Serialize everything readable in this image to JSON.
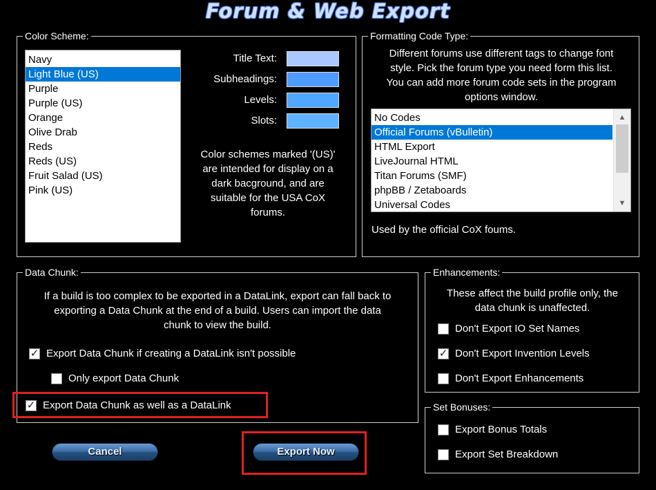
{
  "window": {
    "title": "Forum & Web Export"
  },
  "color_scheme": {
    "legend": "Color Scheme:",
    "items": [
      "Navy",
      "Light Blue (US)",
      "Purple",
      "Purple (US)",
      "Orange",
      "Olive Drab",
      "Reds",
      "Reds (US)",
      "Fruit Salad (US)",
      "Pink (US)"
    ],
    "selected": "Light Blue (US)",
    "swatches": [
      {
        "label": "Title Text:",
        "color": "#aac8ff"
      },
      {
        "label": "Subheadings:",
        "color": "#4f9cff"
      },
      {
        "label": "Levels:",
        "color": "#4fa8ff"
      },
      {
        "label": "Slots:",
        "color": "#5eb2ff"
      }
    ],
    "note_lines": [
      "Color schemes marked '(US)'",
      "are intended for display on a",
      "dark bacground, and are",
      "suitable for the USA CoX",
      "forums."
    ]
  },
  "formatting": {
    "legend": "Formatting Code Type:",
    "description_lines": [
      "Different forums use different tags to change font",
      "style. Pick the forum type you need form this list.",
      "You can add more forum code sets in the program",
      "options window."
    ],
    "items": [
      "No Codes",
      "Official Forums (vBulletin)",
      "HTML Export",
      "LiveJournal HTML",
      "Titan Forums (SMF)",
      "phpBB / Zetaboards",
      "Universal Codes"
    ],
    "selected": "Official Forums (vBulletin)",
    "footer": "Used by the official CoX foums."
  },
  "data_chunk": {
    "legend": "Data Chunk:",
    "description_lines": [
      "If a build is too complex to be exported in a DataLink, export can fall back to",
      "exporting a Data Chunk at the end of a build. Users can import the data",
      "chunk to view the build."
    ],
    "checkboxes": [
      {
        "label": "Export Data Chunk if creating a DataLink isn't possible",
        "checked": true
      },
      {
        "label": "Only export Data Chunk",
        "checked": false
      },
      {
        "label": "Export Data Chunk as well as a DataLink",
        "checked": true
      }
    ]
  },
  "enhancements": {
    "legend": "Enhancements:",
    "description_lines": [
      "These affect the build profile only, the",
      "data chunk is unaffected."
    ],
    "checkboxes": [
      {
        "label": "Don't Export IO Set Names",
        "checked": false
      },
      {
        "label": "Don't Export Invention Levels",
        "checked": true
      },
      {
        "label": "Don't Export Enhancements",
        "checked": false
      }
    ]
  },
  "set_bonuses": {
    "legend": "Set Bonuses:",
    "checkboxes": [
      {
        "label": "Export Bonus Totals",
        "checked": false
      },
      {
        "label": "Export Set Breakdown",
        "checked": false
      }
    ]
  },
  "buttons": {
    "cancel": "Cancel",
    "export_now": "Export Now"
  },
  "colors": {
    "selection": "#0078d7",
    "highlight": "#e02020",
    "button": "#3b6ea8"
  }
}
